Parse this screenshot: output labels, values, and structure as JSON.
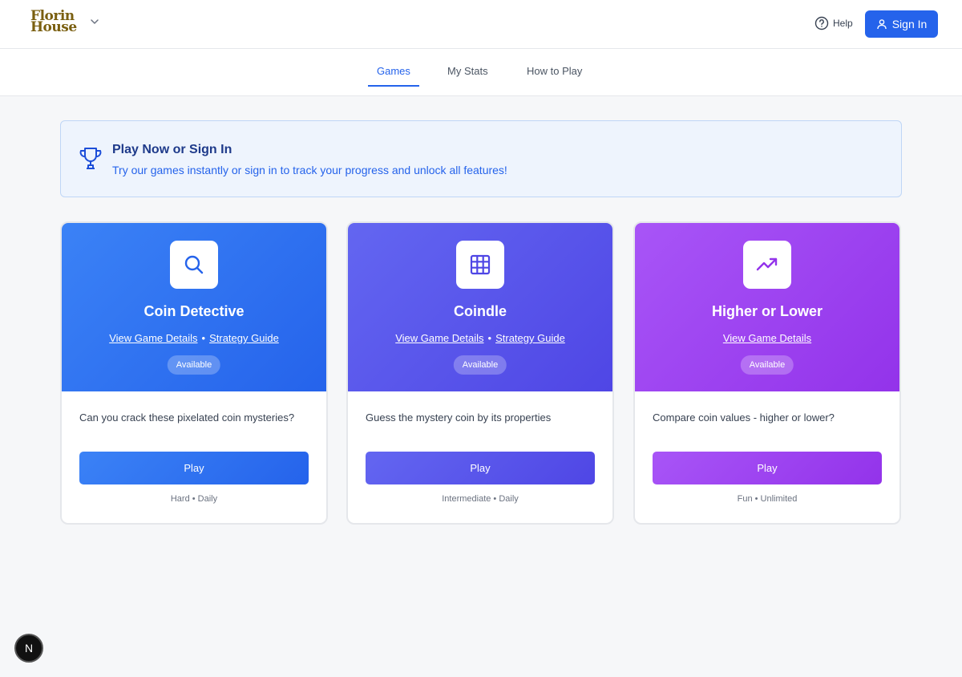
{
  "header": {
    "logo_line1": "Florin",
    "logo_line2": "House",
    "help_label": "Help",
    "signin_label": "Sign In"
  },
  "tabs": [
    {
      "label": "Games",
      "active": true
    },
    {
      "label": "My Stats",
      "active": false
    },
    {
      "label": "How to Play",
      "active": false
    }
  ],
  "banner": {
    "title": "Play Now or Sign In",
    "text": "Try our games instantly or sign in to track your progress and unlock all features!"
  },
  "cards": [
    {
      "title": "Coin Detective",
      "icon": "search-icon",
      "link1": "View Game Details",
      "link2": "Strategy Guide",
      "separator": "•",
      "status": "Available",
      "description": "Can you crack these pixelated coin mysteries?",
      "play_label": "Play",
      "meta": "Hard • Daily",
      "color": "#3b82f6"
    },
    {
      "title": "Coindle",
      "icon": "grid-icon",
      "link1": "View Game Details",
      "link2": "Strategy Guide",
      "separator": "•",
      "status": "Available",
      "description": "Guess the mystery coin by its properties",
      "play_label": "Play",
      "meta": "Intermediate • Daily",
      "color": "#4f46e5"
    },
    {
      "title": "Higher or Lower",
      "icon": "trending-up-icon",
      "link1": "View Game Details",
      "status": "Available",
      "description": "Compare coin values - higher or lower?",
      "play_label": "Play",
      "meta": "Fun • Unlimited",
      "color": "#9333ea"
    }
  ],
  "corner_badge": "N"
}
